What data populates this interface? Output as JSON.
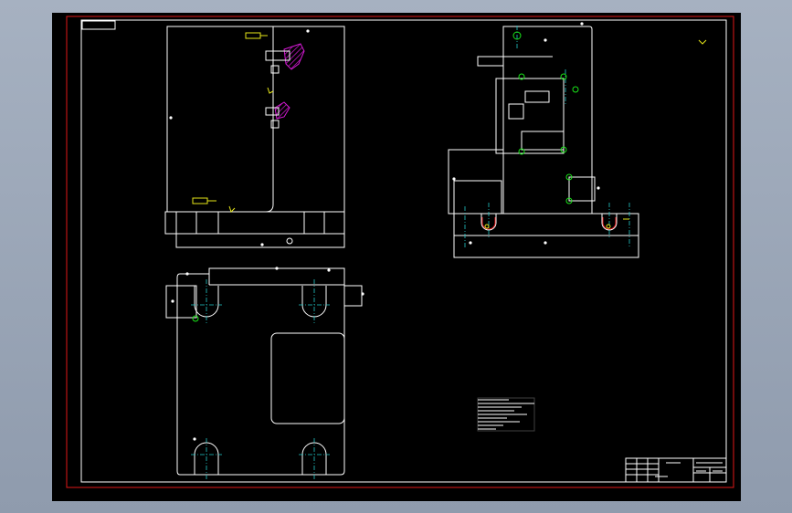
{
  "drawing": {
    "title_block": {
      "left_cells": [
        "",
        "",
        "",
        ""
      ],
      "name": "",
      "sheet": ""
    },
    "tech_notes": [
      "",
      "",
      "",
      "",
      "",
      "",
      "",
      "",
      ""
    ]
  },
  "colors": {
    "background": "#000000",
    "frame": "#e01919",
    "lines": "#ffffff",
    "center_lines": "#22c9c9",
    "dimensions": "#e6e619",
    "hatching": "#d419d4",
    "points": "#19e619"
  }
}
